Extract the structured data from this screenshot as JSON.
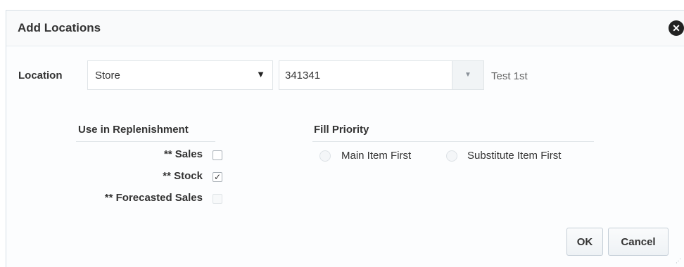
{
  "dialog": {
    "title": "Add Locations",
    "close_icon": "close-icon"
  },
  "location": {
    "label": "Location",
    "type_value": "Store",
    "type_arrow": "▼",
    "id_value": "341341",
    "lov_arrow": "▼",
    "description": "Test 1st"
  },
  "replenishment": {
    "title": "Use in Replenishment",
    "items": [
      {
        "label": "** Sales",
        "checked": false,
        "enabled": true
      },
      {
        "label": "** Stock",
        "checked": true,
        "enabled": true
      },
      {
        "label": "** Forecasted Sales",
        "checked": false,
        "enabled": false
      }
    ]
  },
  "fill_priority": {
    "title": "Fill Priority",
    "options": [
      {
        "label": "Main Item First",
        "enabled": false
      },
      {
        "label": "Substitute Item First",
        "enabled": false
      }
    ]
  },
  "buttons": {
    "ok": "OK",
    "cancel": "Cancel"
  },
  "colors": {
    "title_bar": "#f9fafb",
    "border": "#dfe4e7",
    "text": "#333333",
    "muted_text": "#666666"
  }
}
